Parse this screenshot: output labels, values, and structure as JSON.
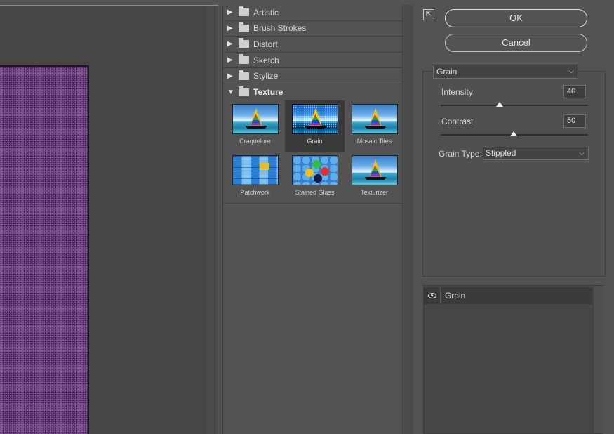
{
  "gallery": {
    "categories": [
      {
        "label": "Artistic"
      },
      {
        "label": "Brush Strokes"
      },
      {
        "label": "Distort"
      },
      {
        "label": "Sketch"
      },
      {
        "label": "Stylize"
      },
      {
        "label": "Texture"
      }
    ],
    "texture_filters": [
      {
        "label": "Craquelure"
      },
      {
        "label": "Grain"
      },
      {
        "label": "Mosaic Tiles"
      },
      {
        "label": "Patchwork"
      },
      {
        "label": "Stained Glass"
      },
      {
        "label": "Texturizer"
      }
    ],
    "selected_filter": "Grain"
  },
  "buttons": {
    "ok": "OK",
    "cancel": "Cancel"
  },
  "settings": {
    "filter_select": "Grain",
    "intensity_label": "Intensity",
    "intensity_value": "40",
    "contrast_label": "Contrast",
    "contrast_value": "50",
    "grain_type_label": "Grain Type:",
    "grain_type_value": "Stippled"
  },
  "layers": [
    {
      "label": "Grain"
    }
  ],
  "icons": {
    "expand_arrow": "▶",
    "collapse_arrow": "▼",
    "chevron": "⌵",
    "collapse_panel": "⇱"
  }
}
